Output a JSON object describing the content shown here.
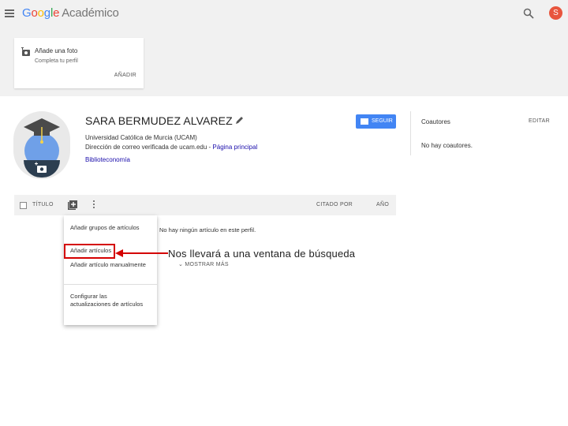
{
  "topbar": {
    "logo_g": [
      "G",
      "o",
      "o",
      "g",
      "l",
      "e"
    ],
    "app_name": "Académico",
    "user_initial": "S"
  },
  "photo_card": {
    "title": "Añade una foto",
    "subtitle": "Completa tu perfil",
    "action": "AÑADIR"
  },
  "profile": {
    "name": "SARA BERMUDEZ ALVAREZ",
    "affiliation": "Universidad Católica de Murcia (UCAM)",
    "email_prefix": "Dirección de correo verificada de ucam.edu - ",
    "homepage_link": "Página principal",
    "interest": "Biblioteconomía",
    "follow_label": "SEGUIR"
  },
  "coauthors": {
    "title": "Coautores",
    "edit_label": "EDITAR",
    "empty": "No hay coautores."
  },
  "table": {
    "title_header": "TÍTULO",
    "cited_header": "CITADO POR",
    "year_header": "AÑO",
    "empty_message": "No hay ningún artículo en este perfil.",
    "show_more": "MOSTRAR MÁS"
  },
  "add_menu": {
    "items": [
      "Añadir grupos de artículos",
      "Añadir artículos",
      "Añadir artículo manualmente",
      "Configurar las actualizaciones de artículos"
    ]
  },
  "annotation": {
    "text": "Nos llevará a una ventana de búsqueda",
    "color": "#d40000"
  },
  "colors": {
    "accent": "#4285f4",
    "avatar": "#e8553d"
  }
}
